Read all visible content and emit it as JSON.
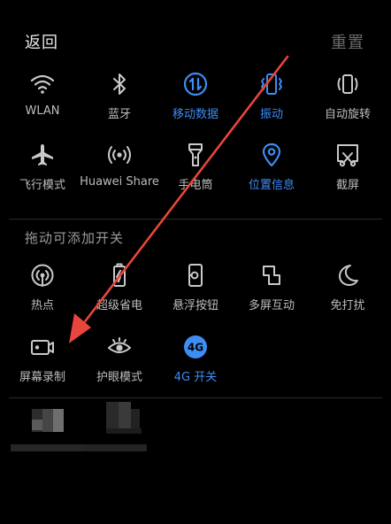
{
  "header": {
    "back_label": "返回",
    "reset_label": "重置"
  },
  "active_tiles": [
    {
      "label": "WLAN",
      "icon": "wifi-icon",
      "on": false
    },
    {
      "label": "蓝牙",
      "icon": "bluetooth-icon",
      "on": false
    },
    {
      "label": "移动数据",
      "icon": "mobile-data-icon",
      "on": true
    },
    {
      "label": "振动",
      "icon": "vibrate-icon",
      "on": true
    },
    {
      "label": "自动旋转",
      "icon": "auto-rotate-icon",
      "on": false
    },
    {
      "label": "飞行模式",
      "icon": "airplane-icon",
      "on": false
    },
    {
      "label": "Huawei Share",
      "icon": "huawei-share-icon",
      "on": false
    },
    {
      "label": "手电筒",
      "icon": "flashlight-icon",
      "on": false
    },
    {
      "label": "位置信息",
      "icon": "location-icon",
      "on": true
    },
    {
      "label": "截屏",
      "icon": "screenshot-icon",
      "on": false
    }
  ],
  "section": {
    "title": "拖动可添加开关"
  },
  "available_tiles": [
    {
      "label": "热点",
      "icon": "hotspot-icon",
      "on": false
    },
    {
      "label": "超级省电",
      "icon": "battery-saver-icon",
      "on": false
    },
    {
      "label": "悬浮按钮",
      "icon": "floating-button-icon",
      "on": false
    },
    {
      "label": "多屏互动",
      "icon": "multi-screen-icon",
      "on": false
    },
    {
      "label": "免打扰",
      "icon": "do-not-disturb-icon",
      "on": false
    },
    {
      "label": "屏幕录制",
      "icon": "screen-record-icon",
      "on": false
    },
    {
      "label": "护眼模式",
      "icon": "eye-comfort-icon",
      "on": false
    },
    {
      "label": "4G 开关",
      "icon": "4g-switch-icon",
      "on": true
    }
  ],
  "colors": {
    "accent": "#3d8df5",
    "icon_default": "#c9c9c9",
    "background": "#000000",
    "annotation_arrow": "#e8453c"
  }
}
